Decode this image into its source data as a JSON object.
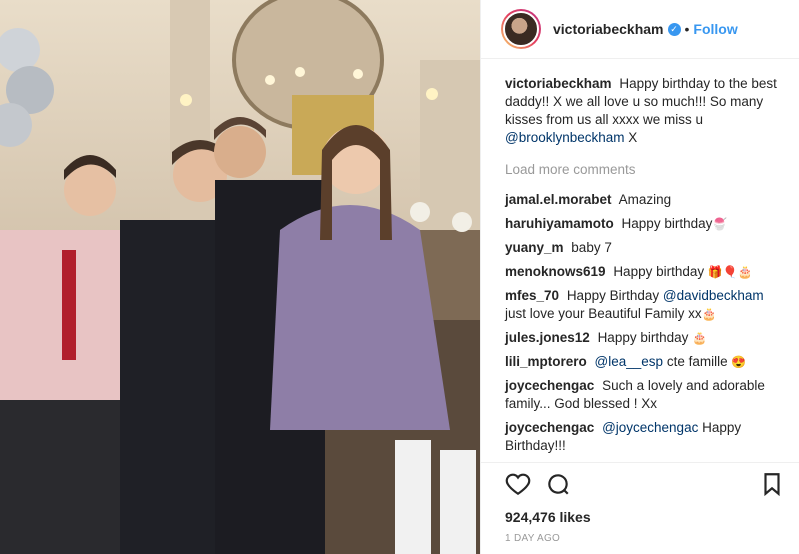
{
  "post": {
    "username": "victoriabeckham",
    "follow_label": "Follow",
    "separator": "•",
    "verified_glyph": "✓"
  },
  "caption": {
    "username": "victoriabeckham",
    "text": "Happy birthday to the best daddy!! X we all love u so much!!! So many kisses from us all xxxx we miss u",
    "mention": "@brooklynbeckham",
    "suffix": " X"
  },
  "load_more_label": "Load more comments",
  "comments": [
    {
      "user": "jamal.el.morabet",
      "text": "Amazing",
      "mention": "",
      "after": "",
      "emoji": ""
    },
    {
      "user": "haruhiyamamoto",
      "text": "Happy birthday",
      "mention": "",
      "after": "",
      "emoji": "🍧"
    },
    {
      "user": "yuany_m",
      "text": "baby 7",
      "mention": "",
      "after": "",
      "emoji": ""
    },
    {
      "user": "menoknows619",
      "text": "Happy birthday",
      "mention": "",
      "after": "",
      "emoji": "🎁🎈🎂"
    },
    {
      "user": "mfes_70",
      "text": "Happy Birthday",
      "mention": "@davidbeckham",
      "after": "just love your Beautiful Family xx",
      "emoji": "🎂"
    },
    {
      "user": "jules.jones12",
      "text": "Happy birthday",
      "mention": "",
      "after": "",
      "emoji": "🎂"
    },
    {
      "user": "lili_mptorero",
      "text": "",
      "mention": "@lea__esp",
      "after": "cte famille",
      "emoji": "😍"
    },
    {
      "user": "joycechengac",
      "text": "Such a lovely and adorable family... God blessed ! Xx",
      "mention": "",
      "after": "",
      "emoji": ""
    },
    {
      "user": "joycechengac",
      "text": "",
      "mention": "@joycechengac",
      "after": "Happy Birthday!!!",
      "emoji": ""
    }
  ],
  "likes": "924,476 likes",
  "date": "1 DAY AGO",
  "icons": {
    "like": "heart-icon",
    "comment": "comment-icon",
    "save": "bookmark-icon"
  },
  "colors": {
    "link": "#3897f0",
    "mention": "#003569",
    "muted": "#999999"
  }
}
